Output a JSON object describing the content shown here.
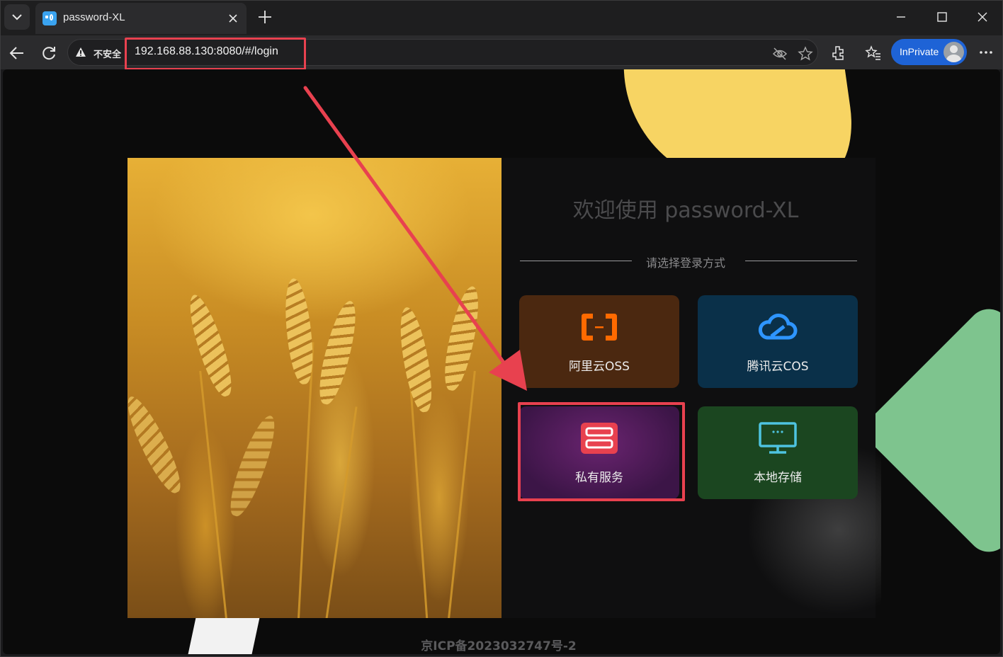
{
  "browser": {
    "tab": {
      "title": "password-XL",
      "close_icon": "close-icon"
    },
    "address_bar": {
      "security_label": "不安全",
      "url": "192.168.88.130:8080/#/login"
    },
    "profile": {
      "label": "InPrivate"
    }
  },
  "page": {
    "welcome_title": "欢迎使用 password-XL",
    "login_prompt": "请选择登录方式",
    "login_options": [
      {
        "label": "阿里云OSS",
        "icon": "aliyun-logo-icon",
        "color": "#4b2810",
        "accent": "#ff6a00"
      },
      {
        "label": "腾讯云COS",
        "icon": "tencent-cloud-icon",
        "color": "#0a3049",
        "accent": "#2e95ff"
      },
      {
        "label": "私有服务",
        "icon": "server-icon",
        "color": "#5a1e63",
        "accent": "#e8414f"
      },
      {
        "label": "本地存储",
        "icon": "monitor-icon",
        "color": "#1b4620",
        "accent": "#4ec3e0"
      }
    ],
    "icp": "京ICP备2023032747号-2"
  },
  "annotations": {
    "highlight_color": "#e8414f"
  }
}
